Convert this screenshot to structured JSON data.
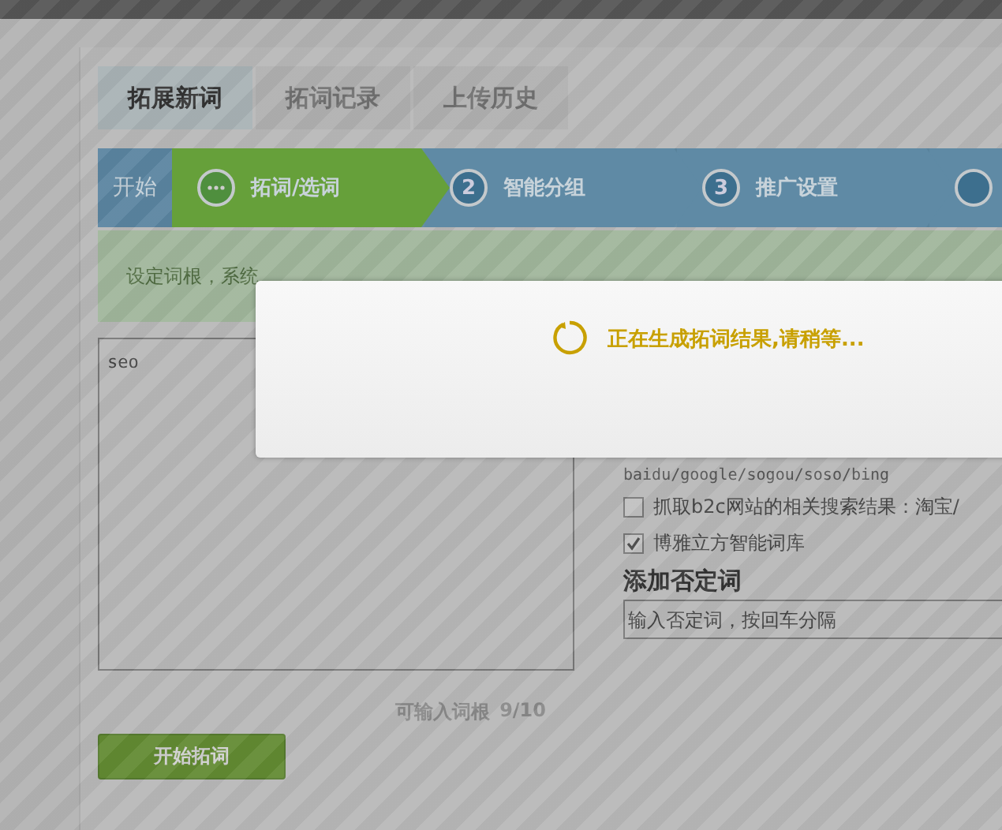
{
  "tabs": [
    {
      "label": "拓展新词",
      "selected": true
    },
    {
      "label": "拓词记录",
      "selected": false
    },
    {
      "label": "上传历史",
      "selected": false
    }
  ],
  "steps": {
    "start": "开始",
    "items": [
      {
        "label": "拓词/选词",
        "selected": true
      },
      {
        "number": "2",
        "label": "智能分组",
        "selected": false
      },
      {
        "number": "3",
        "label": "推广设置",
        "selected": false
      },
      {
        "selected": false
      }
    ]
  },
  "info": "设定词根，系统",
  "seed_words": {
    "value": "seo",
    "counter_label": "可输入词根",
    "counter": "9/10"
  },
  "sources": {
    "engines": "baidu/google/sogou/soso/bing",
    "options": [
      {
        "label": "抓取b2c网站的相关搜索结果：淘宝/",
        "checked": false
      },
      {
        "label": "博雅立方智能词库",
        "checked": true
      }
    ]
  },
  "negative": {
    "title": "添加否定词",
    "placeholder": "输入否定词，按回车分隔"
  },
  "start_button": "开始拓词",
  "dialog": {
    "message": "正在生成拓词结果,请稍等..."
  }
}
